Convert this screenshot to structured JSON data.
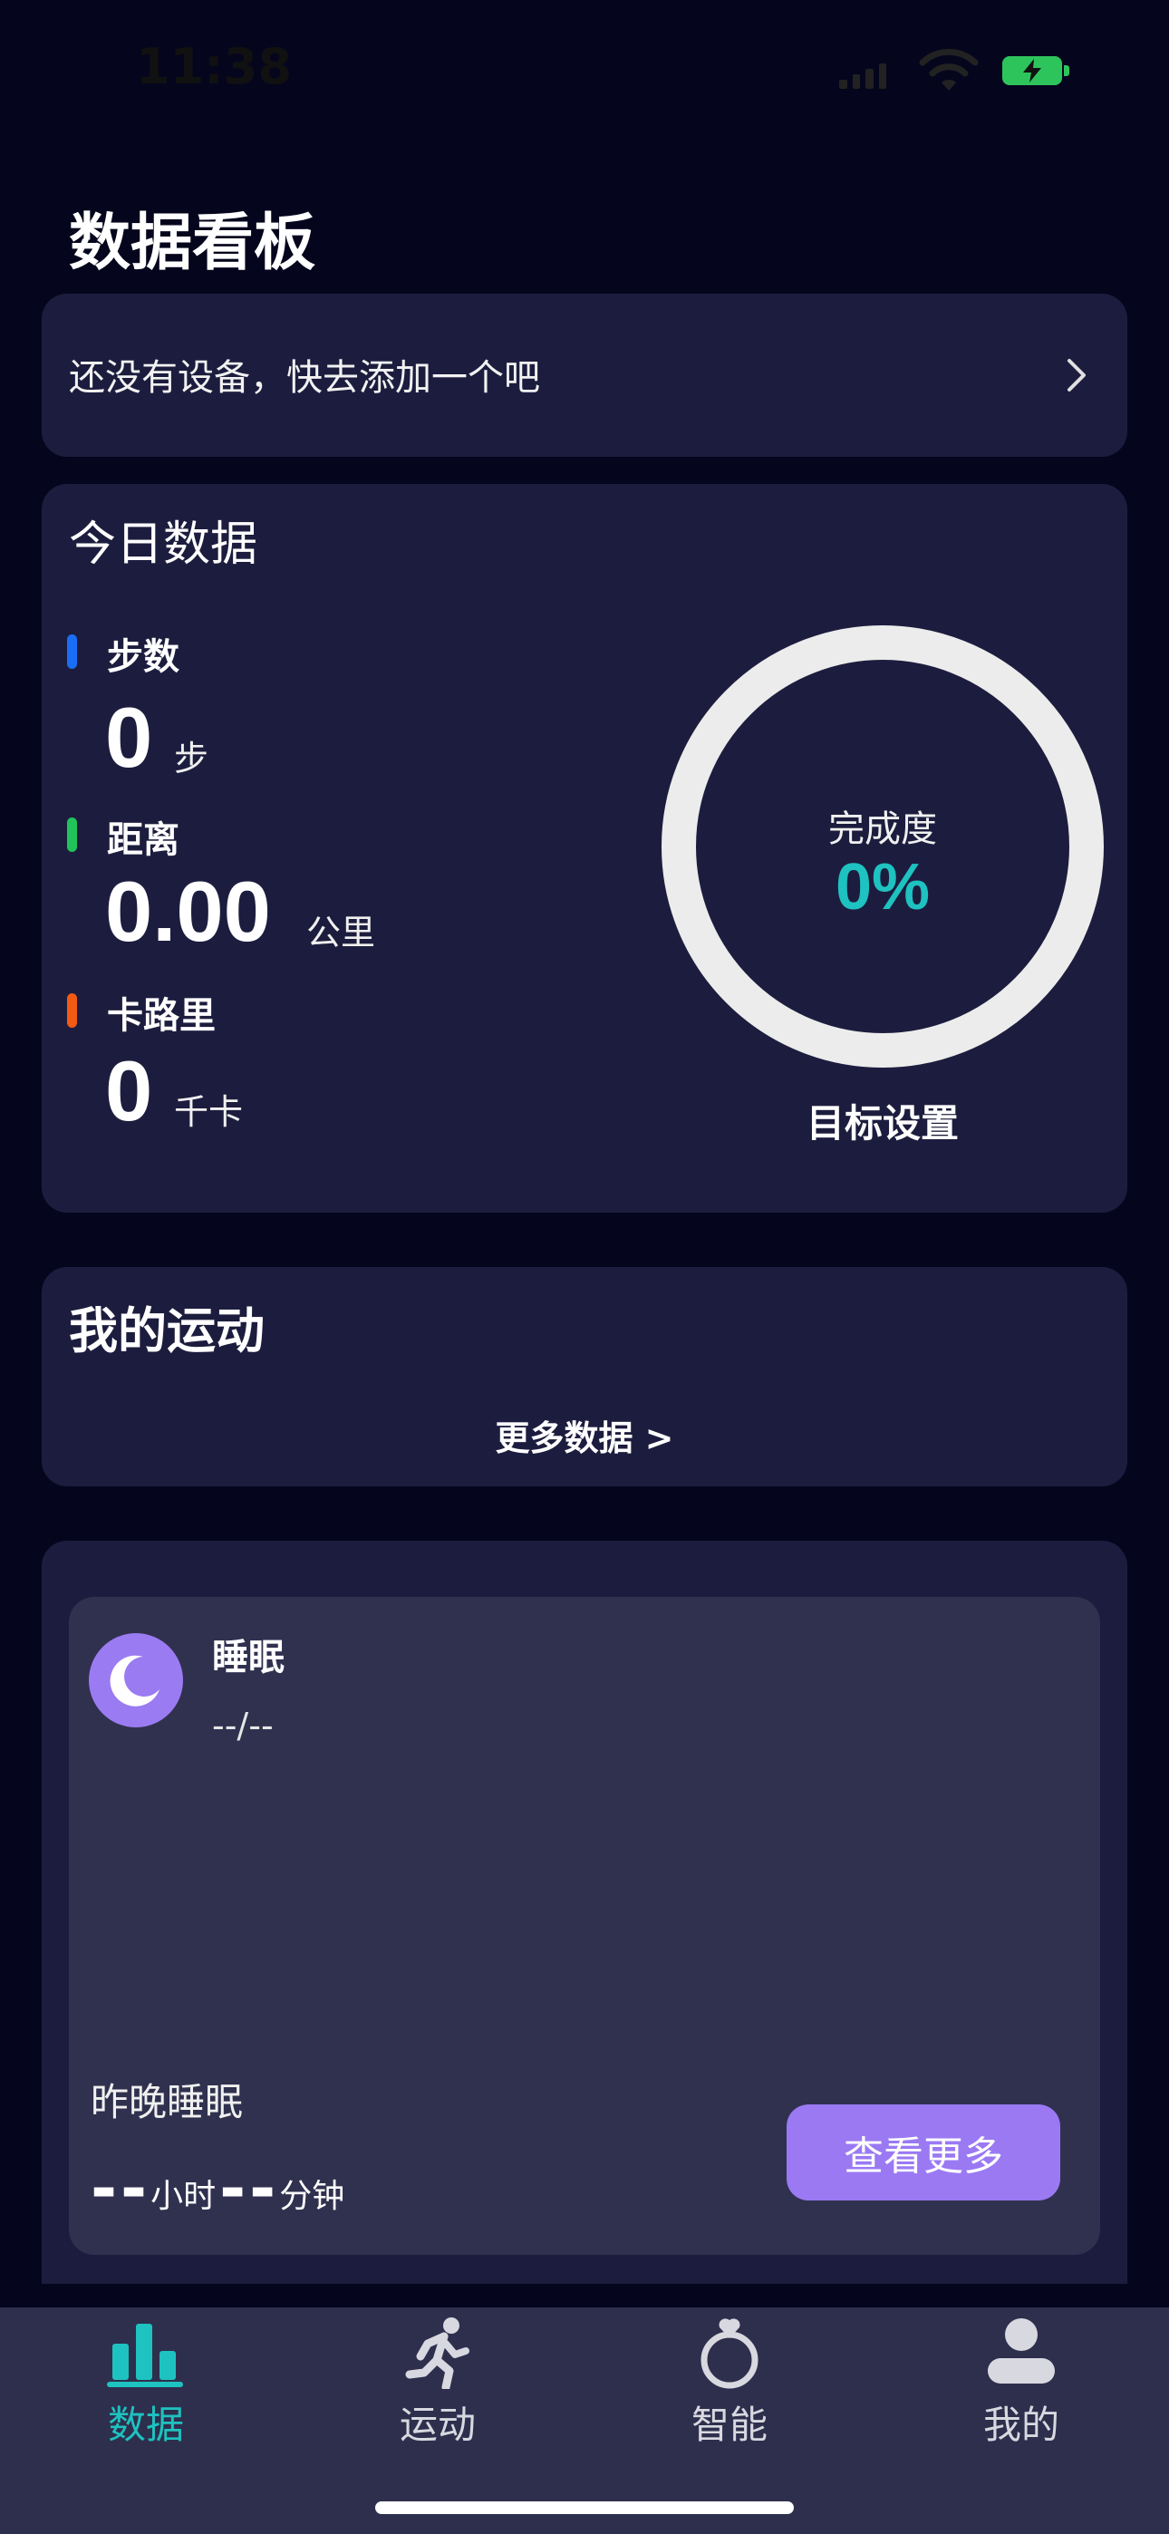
{
  "status_bar": {
    "time": "11:38"
  },
  "page_title": "数据看板",
  "device": {
    "prompt": "还没有设备，快去添加一个吧"
  },
  "today": {
    "title": "今日数据",
    "metrics": [
      {
        "label": "步数",
        "value": "0",
        "unit": "步",
        "color": "#1a6ef5"
      },
      {
        "label": "距离",
        "value": "0.00",
        "unit": "公里",
        "color": "#22c25a"
      },
      {
        "label": "卡路里",
        "value": "0",
        "unit": "千卡",
        "color": "#f25a14"
      }
    ],
    "completion_label": "完成度",
    "completion_value": "0%",
    "goal_setting": "目标设置"
  },
  "sport": {
    "title": "我的运动",
    "more_data": "更多数据 >"
  },
  "sleep": {
    "title": "睡眠",
    "date": "--/--",
    "last_night": "昨晚睡眠",
    "hours_value": "--",
    "hours_unit": "小时",
    "minutes_value": "--",
    "minutes_unit": "分钟",
    "more_button": "查看更多"
  },
  "tabs": [
    {
      "label": "数据",
      "icon": "bar-chart-icon",
      "active": true
    },
    {
      "label": "运动",
      "icon": "running-icon",
      "active": false
    },
    {
      "label": "智能",
      "icon": "ring-icon",
      "active": false
    },
    {
      "label": "我的",
      "icon": "person-icon",
      "active": false
    }
  ],
  "colors": {
    "accent": "#1ec2c0",
    "purple": "#9a79f3",
    "card": "#1c1d3e",
    "background": "#05061d"
  }
}
